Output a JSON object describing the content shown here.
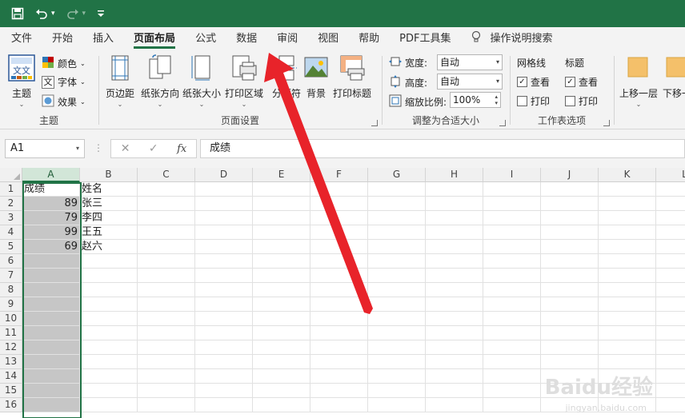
{
  "quick_access": {
    "save_icon": "save-icon",
    "undo_icon": "undo-icon",
    "redo_icon": "redo-icon",
    "customize": "▾"
  },
  "tabs": [
    {
      "label": "文件"
    },
    {
      "label": "开始"
    },
    {
      "label": "插入"
    },
    {
      "label": "页面布局",
      "active": true
    },
    {
      "label": "公式"
    },
    {
      "label": "数据"
    },
    {
      "label": "审阅"
    },
    {
      "label": "视图"
    },
    {
      "label": "帮助"
    },
    {
      "label": "PDF工具集"
    }
  ],
  "tell_me": "操作说明搜索",
  "ribbon": {
    "theme": {
      "label": "主题",
      "themes_btn": "主题",
      "colors": "颜色",
      "fonts": "字体",
      "effects": "效果"
    },
    "page_setup": {
      "label": "页面设置",
      "margins": "页边距",
      "orientation": "纸张方向",
      "size": "纸张大小",
      "print_area": "打印区域",
      "breaks": "分隔符",
      "background": "背景",
      "print_titles": "打印标题"
    },
    "scale": {
      "label": "调整为合适大小",
      "width_label": "宽度:",
      "width_value": "自动",
      "height_label": "高度:",
      "height_value": "自动",
      "scale_label": "缩放比例:",
      "scale_value": "100%"
    },
    "sheet_options": {
      "label": "工作表选项",
      "gridlines": "网格线",
      "headings": "标题",
      "view": "查看",
      "print": "打印"
    },
    "arrange": {
      "bring_forward": "上移一层",
      "send_backward": "下移一"
    }
  },
  "formula_bar": {
    "name_box": "A1",
    "fx": "fx",
    "content": "成绩"
  },
  "columns": [
    "A",
    "B",
    "C",
    "D",
    "E",
    "F",
    "G",
    "H",
    "I",
    "J",
    "K",
    "L"
  ],
  "rows": [
    {
      "num": "1",
      "a": "成绩",
      "b": "姓名"
    },
    {
      "num": "2",
      "a": "89",
      "b": "张三"
    },
    {
      "num": "3",
      "a": "79",
      "b": "李四"
    },
    {
      "num": "4",
      "a": "99",
      "b": "王五"
    },
    {
      "num": "5",
      "a": "69",
      "b": "赵六"
    },
    {
      "num": "6",
      "a": "",
      "b": ""
    },
    {
      "num": "7",
      "a": "",
      "b": ""
    },
    {
      "num": "8",
      "a": "",
      "b": ""
    },
    {
      "num": "9",
      "a": "",
      "b": ""
    },
    {
      "num": "10",
      "a": "",
      "b": ""
    },
    {
      "num": "11",
      "a": "",
      "b": ""
    },
    {
      "num": "12",
      "a": "",
      "b": ""
    },
    {
      "num": "13",
      "a": "",
      "b": ""
    },
    {
      "num": "14",
      "a": "",
      "b": ""
    },
    {
      "num": "15",
      "a": "",
      "b": ""
    },
    {
      "num": "16",
      "a": "",
      "b": ""
    }
  ],
  "watermark": {
    "main": "Baidu经验",
    "sub": "jingyan.baidu.com"
  },
  "colors": {
    "excel_green": "#217346",
    "arrow_red": "#e8232a"
  }
}
